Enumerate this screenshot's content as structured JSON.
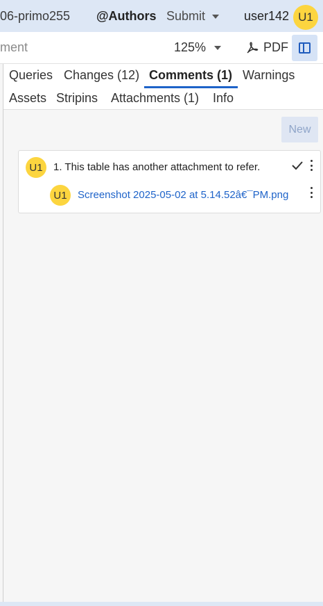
{
  "header": {
    "doc_id": "06-primo255",
    "authors_label": "@Authors",
    "submit_label": "Submit",
    "user_name": "user142",
    "user_initials": "U1"
  },
  "toolbar": {
    "doc_name": "ment",
    "zoom_level": "125%",
    "pdf_label": "PDF"
  },
  "tabs": {
    "row1": [
      "Queries",
      "Changes (12)",
      "Comments (1)",
      "Warnings"
    ],
    "row2": [
      "Assets",
      "Stripins",
      "Attachments (1)",
      "Info"
    ],
    "active": "Comments (1)"
  },
  "comments_panel": {
    "new_button_label": "New",
    "comment": {
      "author_initials": "U1",
      "text": "1. This table has another attachment to refer.",
      "reply_initials": "U1",
      "attachment_name": "Screenshot 2025-05-02 at 5.14.52â€¯PM.png"
    }
  },
  "colors": {
    "accent": "#1e63c9",
    "avatar": "#fcd53f",
    "header_bg": "#dde7f5"
  }
}
